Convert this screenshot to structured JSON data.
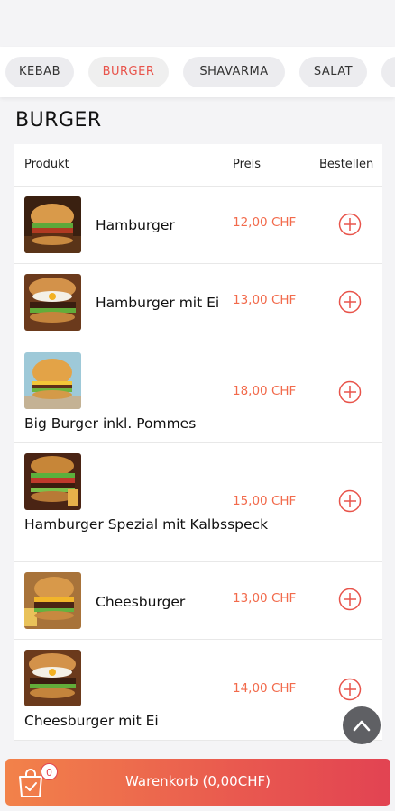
{
  "categories": [
    {
      "label": "KEBAB",
      "active": false
    },
    {
      "label": "BURGER",
      "active": true
    },
    {
      "label": "SHAVARMA",
      "active": false
    },
    {
      "label": "SALAT",
      "active": false
    }
  ],
  "section_title": "BURGER",
  "table": {
    "headers": {
      "product": "Produkt",
      "price": "Preis",
      "order": "Bestellen"
    },
    "rows": [
      {
        "name": "Hamburger",
        "price": "12,00 CHF",
        "icon": "hamburger-photo"
      },
      {
        "name": "Hamburger mit Ei",
        "price": "13,00 CHF",
        "icon": "hamburger-egg-photo"
      },
      {
        "name": "Big Burger inkl. Pommes",
        "price": "18,00 CHF",
        "icon": "big-burger-photo"
      },
      {
        "name": "Hamburger Spezial mit Kalbsspeck",
        "price": "15,00 CHF",
        "icon": "hamburger-special-photo"
      },
      {
        "name": "Cheesburger",
        "price": "13,00 CHF",
        "icon": "cheeseburger-photo"
      },
      {
        "name": "Cheesburger mit Ei",
        "price": "14,00 CHF",
        "icon": "cheeseburger-egg-photo"
      }
    ]
  },
  "cart": {
    "label": "Warenkorb (0,00CHF)",
    "count": "0"
  },
  "colors": {
    "accent": "#e8534a",
    "price": "#f26a4b",
    "cart_start": "#f2824a",
    "cart_end": "#e24352"
  }
}
